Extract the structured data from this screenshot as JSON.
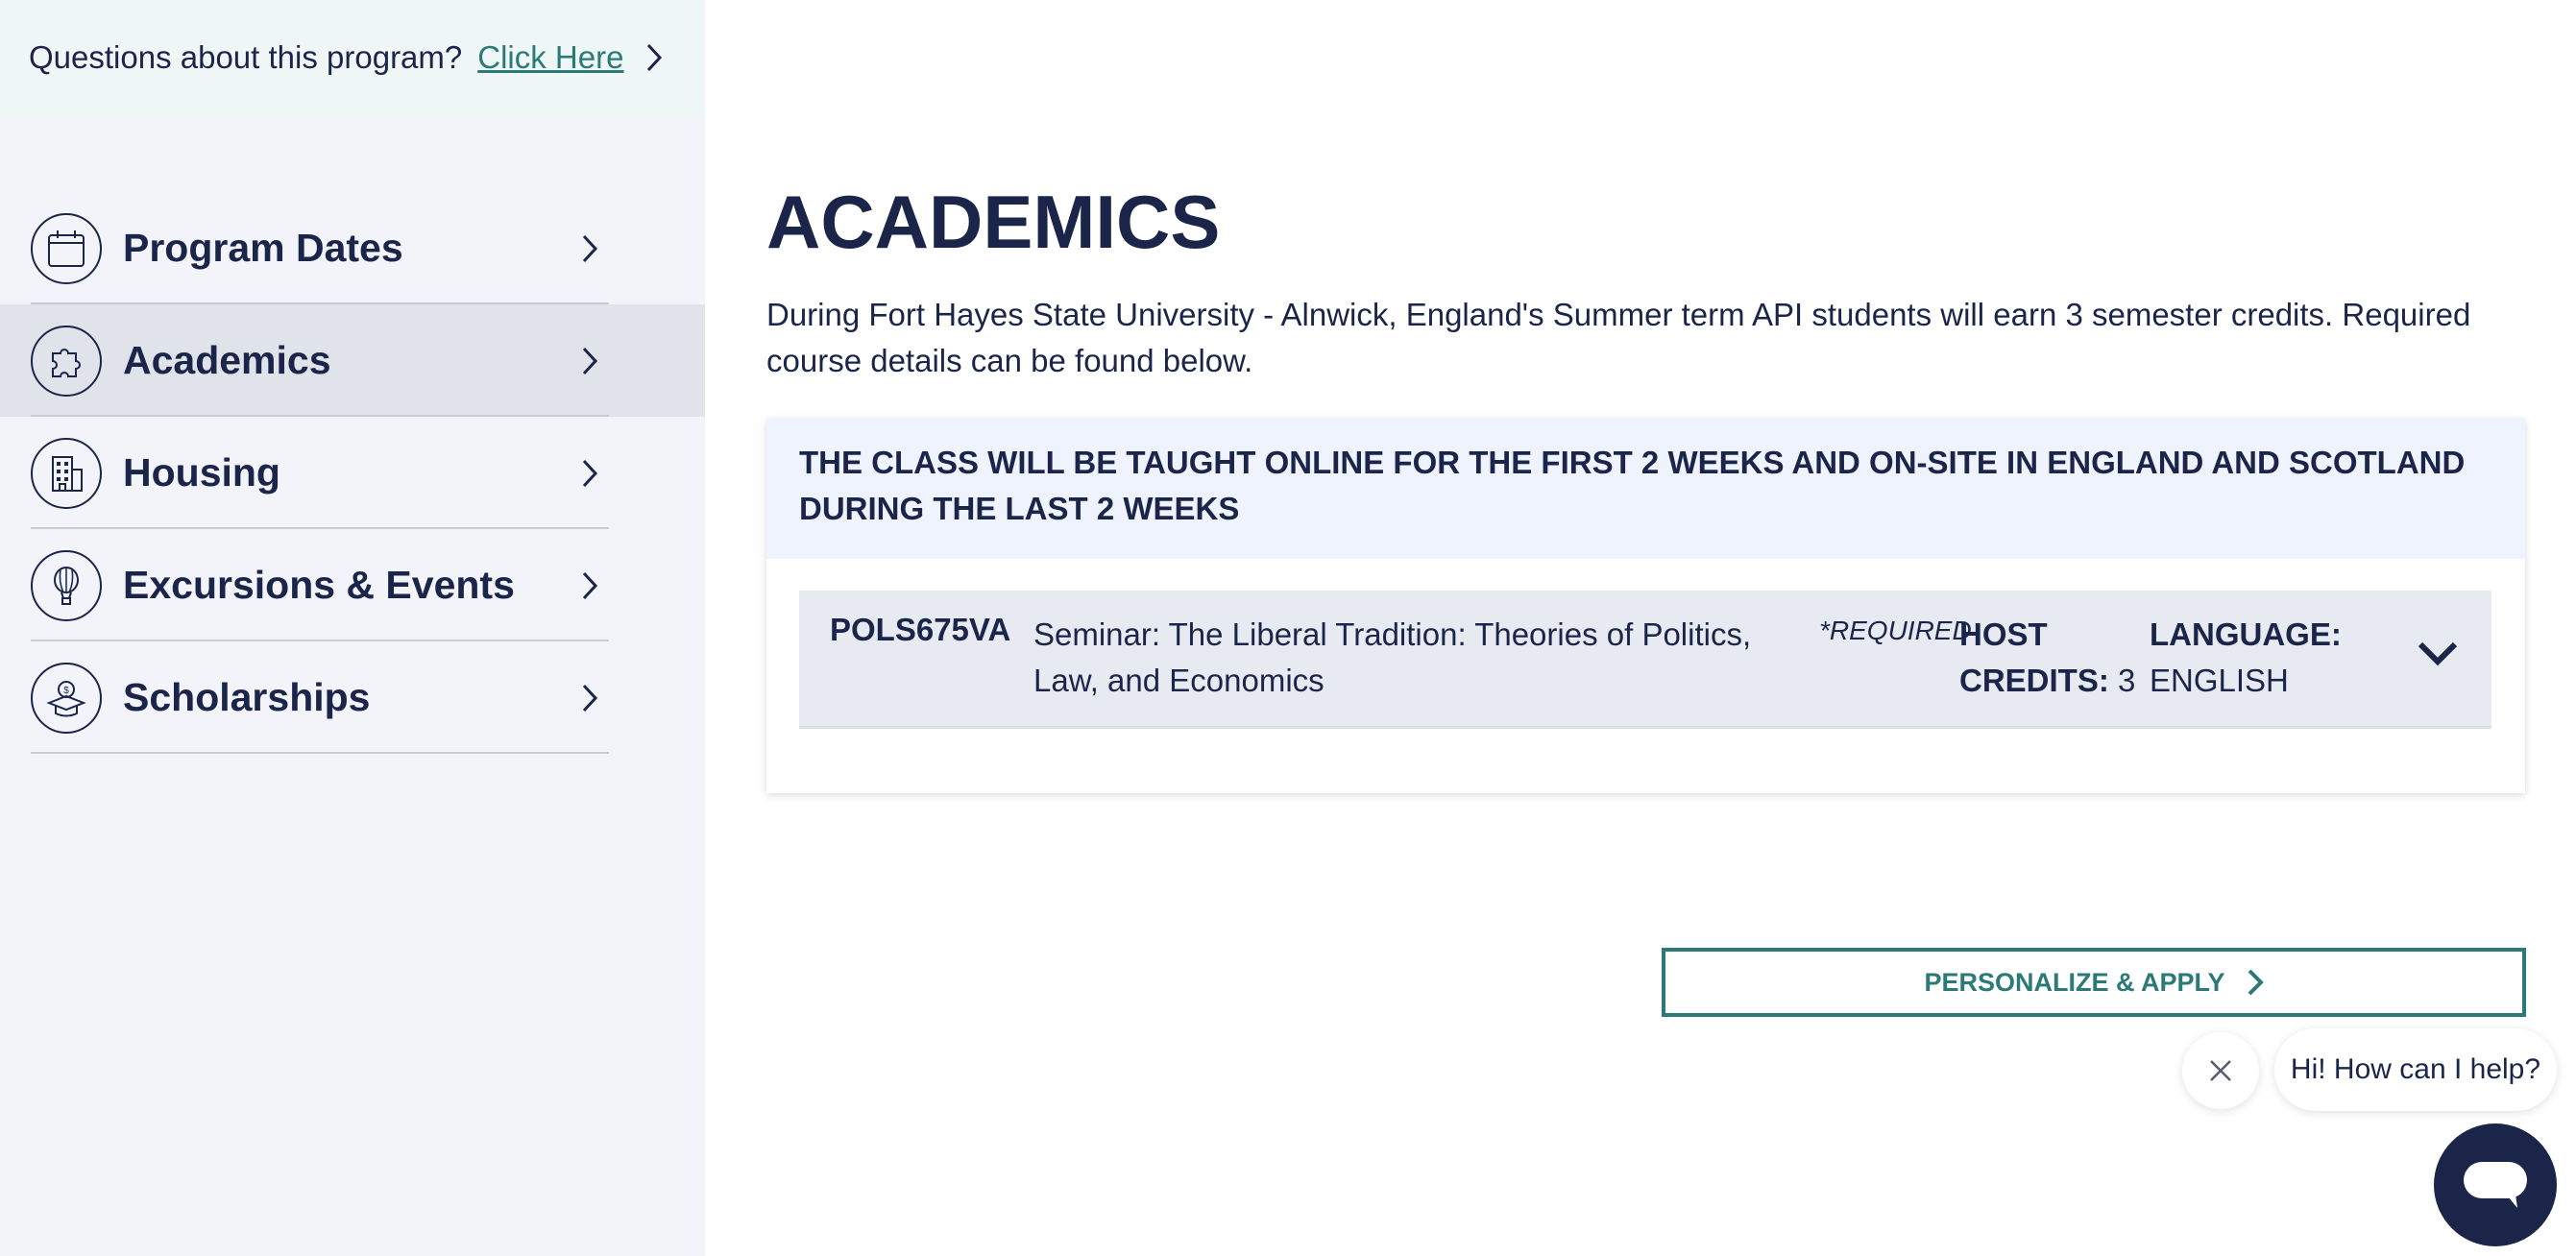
{
  "sidebar": {
    "questions_text": "Questions about this program?",
    "questions_link": "Click Here",
    "items": [
      {
        "label": "Program Dates",
        "icon": "calendar-icon"
      },
      {
        "label": "Academics",
        "icon": "puzzle-icon",
        "active": true
      },
      {
        "label": "Housing",
        "icon": "building-icon"
      },
      {
        "label": "Excursions & Events",
        "icon": "hot-air-balloon-icon"
      },
      {
        "label": "Scholarships",
        "icon": "graduation-cap-icon"
      }
    ]
  },
  "main": {
    "title": "ACADEMICS",
    "intro": "During Fort Hayes State University - Alnwick, England's Summer term API students will earn 3 semester credits. Required course details can be found below.",
    "card_header": "THE CLASS WILL BE TAUGHT ONLINE FOR THE FIRST 2 WEEKS AND ON-SITE IN ENGLAND AND SCOTLAND DURING THE LAST 2 WEEKS",
    "course": {
      "code": "POLS675VA",
      "title": "Seminar: The Liberal Tradition: Theories of Politics, Law, and Economics",
      "required": "*REQUIRED",
      "credits_label": "HOST CREDITS:",
      "credits_value": "3",
      "language_label": "LANGUAGE:",
      "language_value": "ENGLISH"
    },
    "apply_label": "PERSONALIZE & APPLY"
  },
  "chat": {
    "greeting": "Hi! How can I help?"
  },
  "colors": {
    "navy": "#1b2549",
    "teal": "#2b7a78",
    "sidebar_bg": "#f2f4fa",
    "active_item_bg": "#e0e3ea"
  }
}
